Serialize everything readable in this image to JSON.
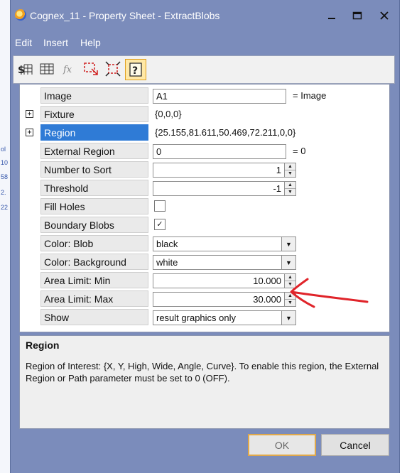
{
  "background": {
    "left_marks": [
      "ol",
      "10",
      "58",
      "2.",
      "22"
    ]
  },
  "window": {
    "title": "Cognex_11 - Property Sheet - ExtractBlobs"
  },
  "menu": {
    "items": [
      "Edit",
      "Insert",
      "Help"
    ]
  },
  "toolbar": {
    "icons": [
      "dollar-grid-icon",
      "grid-icon",
      "function-icon",
      "region-select-icon",
      "fit-region-icon",
      "help-icon"
    ]
  },
  "properties": {
    "image": {
      "name": "Image",
      "value": "A1",
      "suffix": "= Image"
    },
    "fixture": {
      "name": "Fixture",
      "value": "{0,0,0}",
      "expander": "+"
    },
    "region": {
      "name": "Region",
      "value": "{25.155,81.611,50.469,72.211,0,0}",
      "expander": "+"
    },
    "external_region": {
      "name": "External Region",
      "value": "0",
      "suffix": "= 0"
    },
    "number_to_sort": {
      "name": "Number to Sort",
      "value": "1"
    },
    "threshold": {
      "name": "Threshold",
      "value": "-1"
    },
    "fill_holes": {
      "name": "Fill Holes",
      "checked": false
    },
    "boundary_blobs": {
      "name": "Boundary Blobs",
      "checked": true,
      "mark": "✓"
    },
    "color_blob": {
      "name": "Color: Blob",
      "value": "black"
    },
    "color_background": {
      "name": "Color: Background",
      "value": "white"
    },
    "area_limit_min": {
      "name": "Area Limit: Min",
      "value": "10.000"
    },
    "area_limit_max": {
      "name": "Area Limit: Max",
      "value": "30.000"
    },
    "show": {
      "name": "Show",
      "value": "result graphics only"
    }
  },
  "description": {
    "title": "Region",
    "body": "Region of Interest: {X, Y, High, Wide, Angle, Curve}. To enable this region, the External Region or Path parameter must be set to 0 (OFF)."
  },
  "buttons": {
    "ok": "OK",
    "cancel": "Cancel"
  },
  "annotation": {
    "color": "#e0242a"
  }
}
